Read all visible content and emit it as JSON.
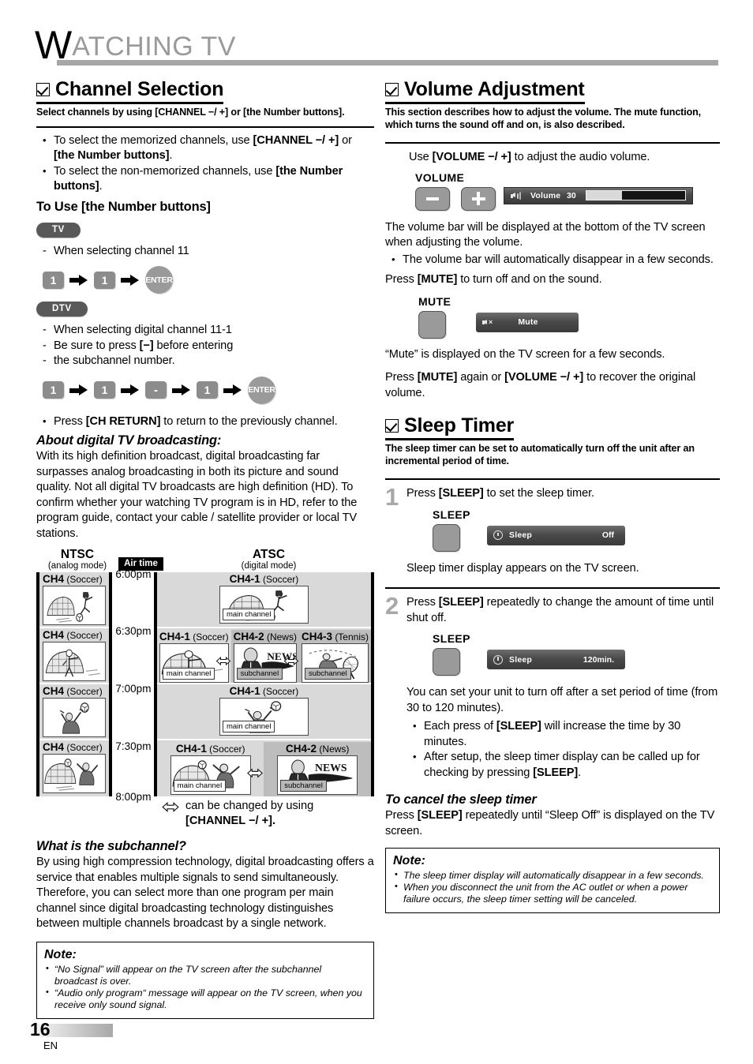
{
  "chapter": {
    "drop_cap": "W",
    "rest": "ATCHING  TV"
  },
  "page_footer": {
    "number": "16",
    "lang": "EN"
  },
  "left": {
    "channel_selection": {
      "title": "Channel Selection",
      "subtitle": "Select channels by using [CHANNEL −/ +] or [the Number buttons].",
      "bullets": [
        {
          "pre": "To select the memorized channels, use ",
          "bold1": "[CHANNEL −/ +]",
          "mid": " or ",
          "bold2": "[the Number buttons]",
          "post": "."
        },
        {
          "pre": "To select the non-memorized channels, use ",
          "bold1": "[the Number buttons]",
          "mid": "",
          "bold2": "",
          "post": "."
        }
      ],
      "to_use_heading_normal": "To Use ",
      "to_use_heading_bold": "[the Number buttons]",
      "tv_badge": "TV",
      "tv_line": "When selecting channel 11",
      "tv_keys": [
        "1",
        "1",
        "ENTER"
      ],
      "dtv_badge": "DTV",
      "dtv_line1": "When selecting digital channel 11-1",
      "dtv_line2_pre": "Be sure to press ",
      "dtv_line2_bold": "[−]",
      "dtv_line2_post": " before entering",
      "dtv_line3": "the subchannel number.",
      "dtv_keys": [
        "1",
        "1",
        "-",
        "1",
        "ENTER"
      ],
      "ch_return_pre": "Press ",
      "ch_return_bold": "[CH RETURN]",
      "ch_return_post": " to return to the previously channel.",
      "about_heading": "About digital TV broadcasting:",
      "about_body": "With its high definition broadcast, digital broadcasting far surpasses analog broadcasting in both its picture and sound quality. Not all digital TV broadcasts are high definition (HD). To confirm whether your watching TV program is in HD, refer to the program guide, contact your cable / satellite provider or local TV stations."
    },
    "guide": {
      "ntsc_title": "NTSC",
      "ntsc_sub": "(analog mode)",
      "air_time_label": "Air time",
      "atsc_title": "ATSC",
      "atsc_sub": "(digital mode)",
      "ticks": [
        "6:00pm",
        "6:30pm",
        "7:00pm",
        "7:30pm",
        "8:00pm"
      ],
      "ntsc_slots": [
        {
          "ch": "CH4",
          "genre": "(Soccer)"
        },
        {
          "ch": "CH4",
          "genre": "(Soccer)"
        },
        {
          "ch": "CH4",
          "genre": "(Soccer)"
        },
        {
          "ch": "CH4",
          "genre": "(Soccer)"
        }
      ],
      "atsc_rows": [
        {
          "cells": [
            {
              "ch": "CH4-1",
              "genre": "(Soccer)",
              "tag": "main channel",
              "kind": "main",
              "art": "soccer1"
            }
          ]
        },
        {
          "cells": [
            {
              "ch": "CH4-1",
              "genre": "(Soccer)",
              "tag": "main channel",
              "kind": "main",
              "art": "soccer2"
            },
            {
              "ch": "CH4-2",
              "genre": "(News)",
              "tag": "subchannel",
              "kind": "sub",
              "art": "news"
            },
            {
              "ch": "CH4-3",
              "genre": "(Tennis)",
              "tag": "subchannel",
              "kind": "sub",
              "art": "tennis"
            }
          ]
        },
        {
          "cells": [
            {
              "ch": "CH4-1",
              "genre": "(Soccer)",
              "tag": "main channel",
              "kind": "main",
              "art": "soccer3"
            }
          ]
        },
        {
          "cells": [
            {
              "ch": "CH4-1",
              "genre": "(Soccer)",
              "tag": "main channel",
              "kind": "main",
              "art": "soccer4"
            },
            {
              "ch": "CH4-2",
              "genre": "(News)",
              "tag": "subchannel",
              "kind": "sub",
              "art": "news"
            }
          ]
        }
      ],
      "foot_line1": "can be changed by using",
      "foot_line2": "[CHANNEL −/ +]."
    },
    "subchannel": {
      "heading": "What is the subchannel?",
      "body1": "By using high compression technology, digital broadcasting offers a service that enables multiple signals to send simultaneously.",
      "body2": "Therefore, you can select more than one program per main channel since digital broadcasting technology distinguishes between multiple channels broadcast by a single network."
    },
    "note": {
      "heading": "Note:",
      "items": [
        "“No Signal” will appear on the TV screen after the subchannel broadcast is over.",
        "“Audio only program“ message will appear on the TV screen, when you receive only sound signal."
      ]
    }
  },
  "right": {
    "volume": {
      "title": "Volume Adjustment",
      "subtitle": "This section describes how to adjust the volume. The mute function, which turns the sound off and on, is also described.",
      "use_pre": "Use ",
      "use_bold": "[VOLUME −/ +]",
      "use_post": " to adjust the audio volume.",
      "volume_label": "VOLUME",
      "minus_key": "−",
      "plus_key": "+",
      "osd": {
        "icon": "speaker-icon",
        "label": "Volume",
        "value": "30",
        "fill_percent": 36
      },
      "para1": "The volume bar will be displayed at the bottom of the TV screen when adjusting the volume.",
      "bullet1": "The volume bar will automatically disappear in a few seconds.",
      "mute_press_pre": "Press ",
      "mute_press_bold": "[MUTE]",
      "mute_press_post": " to turn off and on the sound.",
      "mute_label": "MUTE",
      "mute_osd": {
        "icon": "speaker-mute-icon",
        "label": "Mute"
      },
      "mute_displayed": "“Mute” is displayed on the TV screen for a few seconds.",
      "recover_pre": "Press ",
      "recover_b1": "[MUTE]",
      "recover_mid": " again or ",
      "recover_b2": "[VOLUME −/ +]",
      "recover_post": " to recover the original volume."
    },
    "sleep": {
      "title": "Sleep Timer",
      "subtitle": "The sleep timer can be set to automatically turn off the unit after an incremental period of time.",
      "steps": [
        {
          "num": "1",
          "text_pre": "Press ",
          "text_bold": "[SLEEP]",
          "text_post": " to set the sleep timer.",
          "button_label": "SLEEP",
          "osd": {
            "icon": "clock-icon",
            "label": "Sleep",
            "value": "Off"
          },
          "after": "Sleep timer display appears on the TV screen."
        },
        {
          "num": "2",
          "text_pre": "Press ",
          "text_bold": "[SLEEP]",
          "text_post": " repeatedly to change the amount of time until shut off.",
          "button_label": "SLEEP",
          "osd": {
            "icon": "clock-icon",
            "label": "Sleep",
            "value": "120min."
          },
          "after": "You can set your unit to turn off after a set period of time (from 30 to 120 minutes).",
          "bullets": [
            {
              "pre": "Each press of ",
              "bold": "[SLEEP]",
              "post": " will increase the time by 30 minutes."
            },
            {
              "pre": "After setup, the sleep timer display can be called up for checking by pressing ",
              "bold": "[SLEEP]",
              "post": "."
            }
          ]
        }
      ],
      "cancel_heading": "To cancel the sleep timer",
      "cancel_pre": "Press ",
      "cancel_bold": "[SLEEP]",
      "cancel_post": " repeatedly until “Sleep Off” is displayed on the TV screen.",
      "note": {
        "heading": "Note:",
        "items": [
          "The sleep timer display will automatically disappear in a few seconds.",
          "When you disconnect the unit from the AC outlet or when a power failure occurs, the sleep timer setting will be canceled."
        ]
      }
    }
  }
}
